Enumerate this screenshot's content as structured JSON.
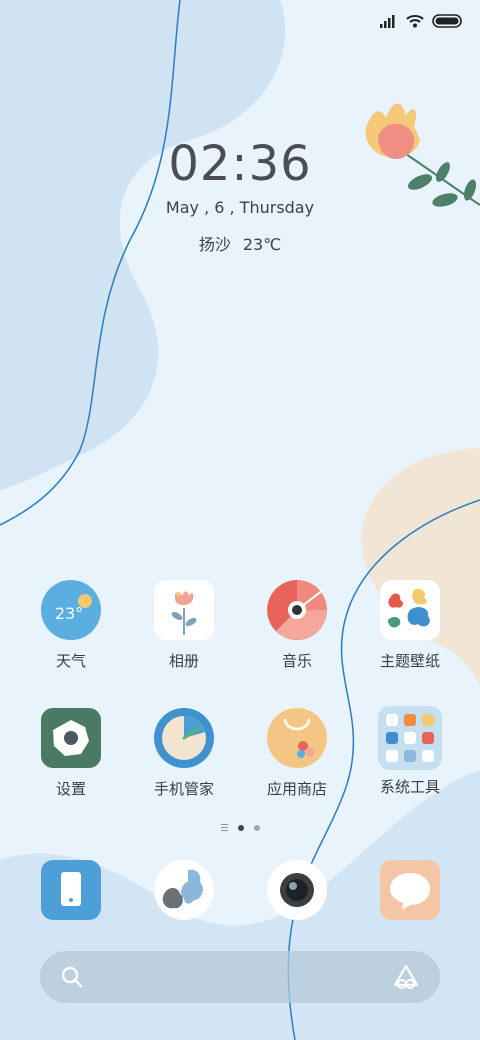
{
  "status_bar": {
    "icons": [
      "signal-icon",
      "wifi-icon",
      "battery-icon"
    ]
  },
  "clock_widget": {
    "time": "02:36",
    "date": "May , 6 , Thursday",
    "city": "扬沙",
    "temperature": "23℃"
  },
  "home": {
    "apps": [
      {
        "label": "天气",
        "icon": "weather-icon",
        "badge": "23°"
      },
      {
        "label": "相册",
        "icon": "gallery-icon"
      },
      {
        "label": "音乐",
        "icon": "music-icon"
      },
      {
        "label": "主题壁纸",
        "icon": "themes-icon"
      },
      {
        "label": "设置",
        "icon": "settings-icon"
      },
      {
        "label": "手机管家",
        "icon": "security-icon"
      },
      {
        "label": "应用商店",
        "icon": "app-store-icon"
      },
      {
        "label": "系统工具",
        "icon": "folder-icon"
      }
    ],
    "page_indicator": {
      "pages": 2,
      "current": 1
    }
  },
  "dock": {
    "apps": [
      {
        "icon": "phone-icon"
      },
      {
        "icon": "browser-icon"
      },
      {
        "icon": "camera-icon"
      },
      {
        "icon": "messages-icon"
      }
    ]
  },
  "search_bar": {
    "icons": [
      "search-icon",
      "assistant-icon"
    ]
  },
  "colors": {
    "background": "#e8f3fb",
    "blob_blue": "#cfe4f4",
    "blob_beige": "#f1e7d6",
    "curve_line": "#2b7bc6"
  }
}
